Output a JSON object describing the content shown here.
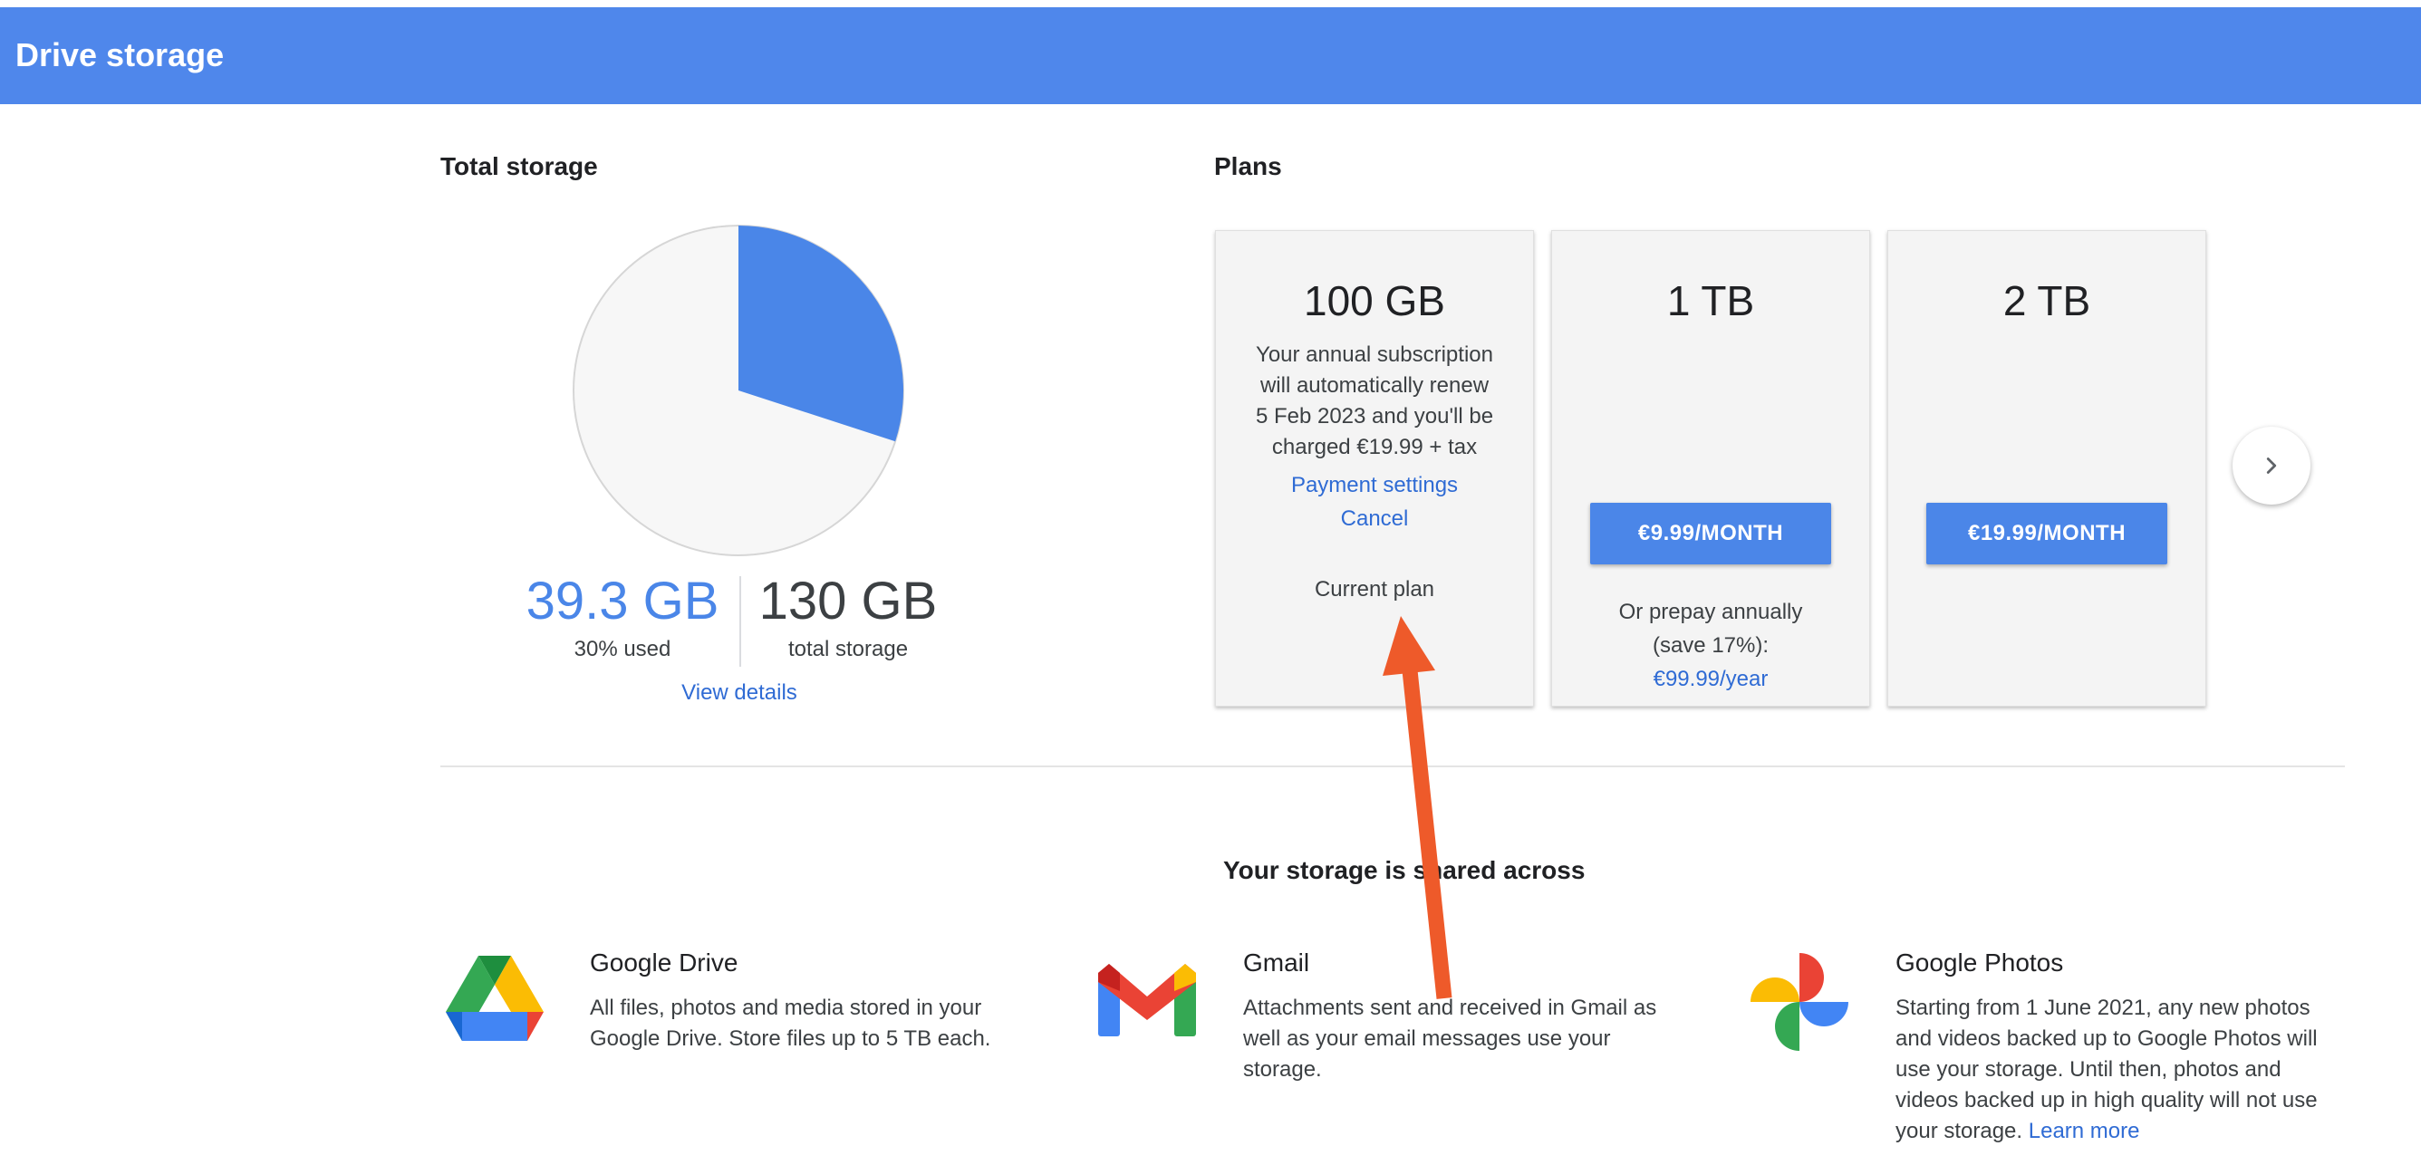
{
  "header": {
    "title": "Drive storage"
  },
  "total_storage": {
    "heading": "Total storage",
    "used_value": "39.3 GB",
    "used_caption": "30% used",
    "used_fraction": 0.3,
    "total_value": "130 GB",
    "total_caption": "total storage",
    "view_details": "View details",
    "colors": {
      "used": "#4a86e8",
      "free": "#f7f7f7"
    }
  },
  "plans": {
    "heading": "Plans",
    "current": {
      "size": "100 GB",
      "desc_lines": [
        "Your annual subscription",
        "will automatically renew",
        "5 Feb 2023 and you'll be",
        "charged €19.99 + tax"
      ],
      "payment_settings": "Payment settings",
      "cancel": "Cancel",
      "current_label": "Current plan"
    },
    "options": [
      {
        "size": "1 TB",
        "price": "€9.99/MONTH",
        "prepay_lines": [
          "Or prepay annually",
          "(save 17%):"
        ],
        "prepay_price": "€99.99/year"
      },
      {
        "size": "2 TB",
        "price": "€19.99/MONTH"
      }
    ],
    "next_icon": "chevron-right-icon"
  },
  "shared": {
    "title": "Your storage is shared across",
    "services": [
      {
        "name": "Google Drive",
        "icon": "google-drive-icon",
        "desc_lines": [
          "All files, photos and media stored in your",
          "Google Drive. Store files up to 5 TB each."
        ]
      },
      {
        "name": "Gmail",
        "icon": "gmail-icon",
        "desc_lines": [
          "Attachments sent and received in Gmail as",
          "well as your email messages use your",
          "storage."
        ]
      },
      {
        "name": "Google Photos",
        "icon": "google-photos-icon",
        "desc_lines": [
          "Starting from 1 June 2021, any new photos",
          "and videos backed up to Google Photos will",
          "use your storage. Until then, photos and",
          "videos backed up in high quality will not use"
        ],
        "last_line": "your storage.",
        "learn_more": "Learn more"
      }
    ]
  },
  "annotation": {
    "color": "#ee5a2a"
  }
}
